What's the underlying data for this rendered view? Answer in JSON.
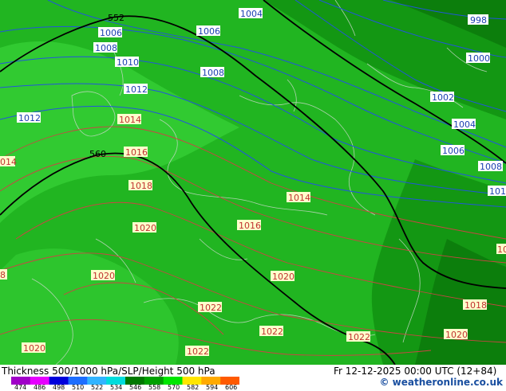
{
  "map": {
    "colors": {
      "field_light": "#33cc33",
      "field_mid": "#21b521",
      "field_dark": "#139713",
      "field_darker": "#0c7e0c",
      "isobar": "#2255dd",
      "isobar_high": "#cc4444",
      "height_line": "#000000",
      "border": "#c8d8c8"
    },
    "height_labels": [
      {
        "text": "552"
      },
      {
        "text": "560"
      }
    ],
    "isobar_labels": [
      {
        "text": "1004"
      },
      {
        "text": "998"
      },
      {
        "text": "1006"
      },
      {
        "text": "1006"
      },
      {
        "text": "1008"
      },
      {
        "text": "1010"
      },
      {
        "text": "1008"
      },
      {
        "text": "1000"
      },
      {
        "text": "1012"
      },
      {
        "text": "1002"
      },
      {
        "text": "1012"
      },
      {
        "text": "1004"
      },
      {
        "text": "1006"
      },
      {
        "text": "1008"
      },
      {
        "text": "101"
      }
    ],
    "high_labels": [
      {
        "text": "1014"
      },
      {
        "text": "014"
      },
      {
        "text": "1016"
      },
      {
        "text": "1018"
      },
      {
        "text": "1014"
      },
      {
        "text": "1020"
      },
      {
        "text": "1016"
      },
      {
        "text": "10"
      },
      {
        "text": "8"
      },
      {
        "text": "1020"
      },
      {
        "text": "1020"
      },
      {
        "text": "1018"
      },
      {
        "text": "1022"
      },
      {
        "text": "1022"
      },
      {
        "text": "1022"
      },
      {
        "text": "1020"
      },
      {
        "text": "1020"
      },
      {
        "text": "1022"
      }
    ]
  },
  "footer": {
    "title": "Thickness 500/1000 hPa/SLP/Height 500 hPa",
    "datetime": "Fr 12-12-2025 00:00 UTC (12+84)",
    "credit_symbol": "©",
    "credit": "weatheronline.co.uk",
    "legend_ticks": [
      "474",
      "486",
      "498",
      "510",
      "522",
      "534",
      "546",
      "558",
      "570",
      "582",
      "594",
      "606"
    ],
    "legend_colors": [
      "#a000c8",
      "#e600ff",
      "#0000dc",
      "#1e6eff",
      "#32b4ff",
      "#00dcdc",
      "#007800",
      "#00a000",
      "#00e600",
      "#ffe600",
      "#ffaa00",
      "#ff5a00"
    ]
  }
}
